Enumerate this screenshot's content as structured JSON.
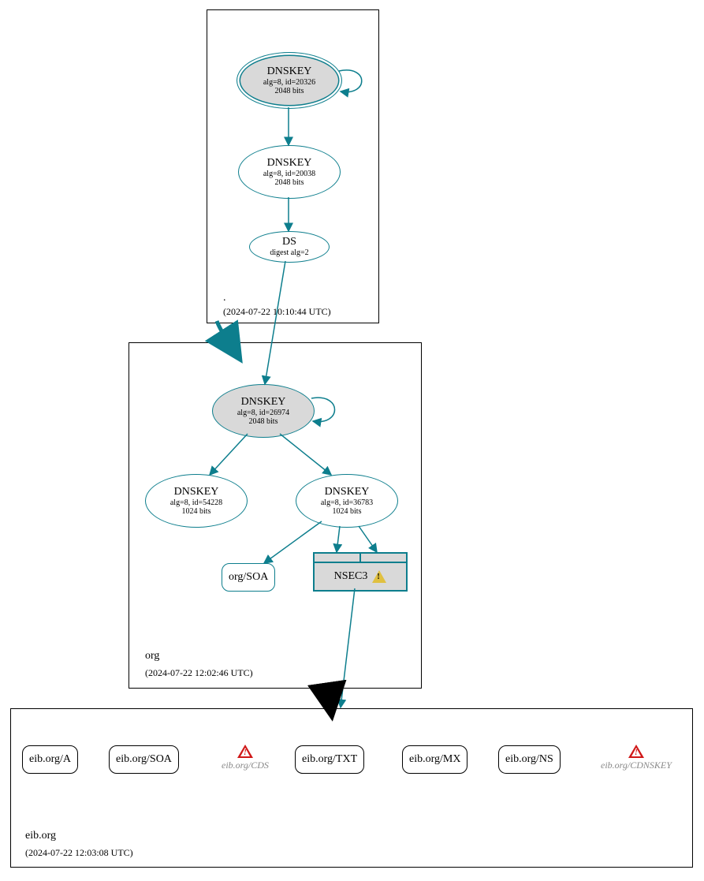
{
  "zones": {
    "root": {
      "label": ".",
      "timestamp": "(2024-07-22 10:10:44 UTC)"
    },
    "org": {
      "label": "org",
      "timestamp": "(2024-07-22 12:02:46 UTC)"
    },
    "eib": {
      "label": "eib.org",
      "timestamp": "(2024-07-22 12:03:08 UTC)"
    }
  },
  "nodes": {
    "root_ksk": {
      "title": "DNSKEY",
      "sub1": "alg=8, id=20326",
      "sub2": "2048 bits"
    },
    "root_zsk": {
      "title": "DNSKEY",
      "sub1": "alg=8, id=20038",
      "sub2": "2048 bits"
    },
    "root_ds": {
      "title": "DS",
      "sub1": "digest alg=2"
    },
    "org_ksk": {
      "title": "DNSKEY",
      "sub1": "alg=8, id=26974",
      "sub2": "2048 bits"
    },
    "org_zsk1": {
      "title": "DNSKEY",
      "sub1": "alg=8, id=54228",
      "sub2": "1024 bits"
    },
    "org_zsk2": {
      "title": "DNSKEY",
      "sub1": "alg=8, id=36783",
      "sub2": "1024 bits"
    },
    "org_soa": {
      "label": "org/SOA"
    },
    "nsec3": {
      "label": "NSEC3"
    }
  },
  "leaves": {
    "a": "eib.org/A",
    "soa": "eib.org/SOA",
    "cds": "eib.org/CDS",
    "txt": "eib.org/TXT",
    "mx": "eib.org/MX",
    "ns": "eib.org/NS",
    "cdnskey": "eib.org/CDNSKEY"
  }
}
